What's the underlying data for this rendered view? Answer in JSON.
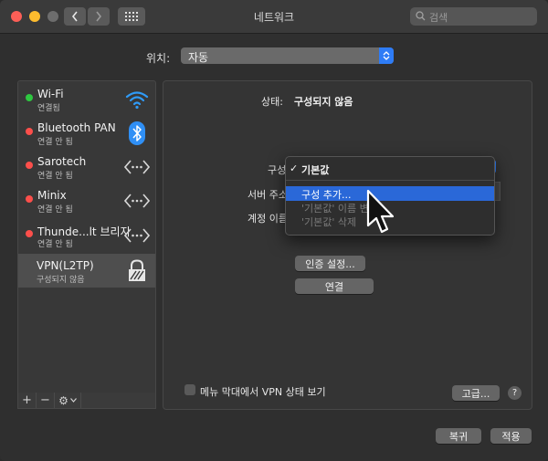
{
  "window": {
    "title": "네트워크"
  },
  "search": {
    "placeholder": "검색"
  },
  "location": {
    "label": "위치:",
    "value": "자동"
  },
  "services": [
    {
      "name": "Wi-Fi",
      "status": "연결됨",
      "status_color": "#2ec840",
      "icon": "wifi-icon"
    },
    {
      "name": "Bluetooth PAN",
      "status": "연결 안 됨",
      "status_color": "#fc4f4b",
      "icon": "bluetooth-icon"
    },
    {
      "name": "Sarotech",
      "status": "연결 안 됨",
      "status_color": "#fc4f4b",
      "icon": "ethernet-arrows-icon"
    },
    {
      "name": "Minix",
      "status": "연결 안 됨",
      "status_color": "#fc4f4b",
      "icon": "ethernet-arrows-icon"
    },
    {
      "name": "Thunde...lt 브리지",
      "status": "연결 안 됨",
      "status_color": "#fc4f4b",
      "icon": "ethernet-arrows-icon"
    },
    {
      "name": "VPN(L2TP)",
      "status": "구성되지 않음",
      "status_color": null,
      "icon": "lock-icon",
      "selected": true
    }
  ],
  "sidebar_buttons": {
    "add": "+",
    "remove": "−",
    "action": "⚙"
  },
  "detail": {
    "status_label": "상태:",
    "status_value": "구성되지 않음",
    "config_label": "구성",
    "server_label": "서버 주소",
    "account_label": "계정 이름",
    "auth_button": "인증 설정...",
    "connect_button": "연결",
    "show_in_menu_label": "메뉴 막대에서 VPN 상태 보기",
    "show_in_menu_checked": false,
    "advanced_button": "고급...",
    "help_button": "?"
  },
  "config_menu": {
    "items": [
      {
        "label": "기본값",
        "checked": true,
        "enabled": true
      },
      {
        "label": "구성 추가...",
        "highlighted": true,
        "enabled": true
      },
      {
        "label": "'기본값' 이름 변경...",
        "enabled": false
      },
      {
        "label": "'기본값' 삭제",
        "enabled": false
      }
    ]
  },
  "footer": {
    "revert_button": "복귀",
    "apply_button": "적용"
  },
  "colors": {
    "accent": "#2e7cf6",
    "highlight": "#2a68d8"
  }
}
